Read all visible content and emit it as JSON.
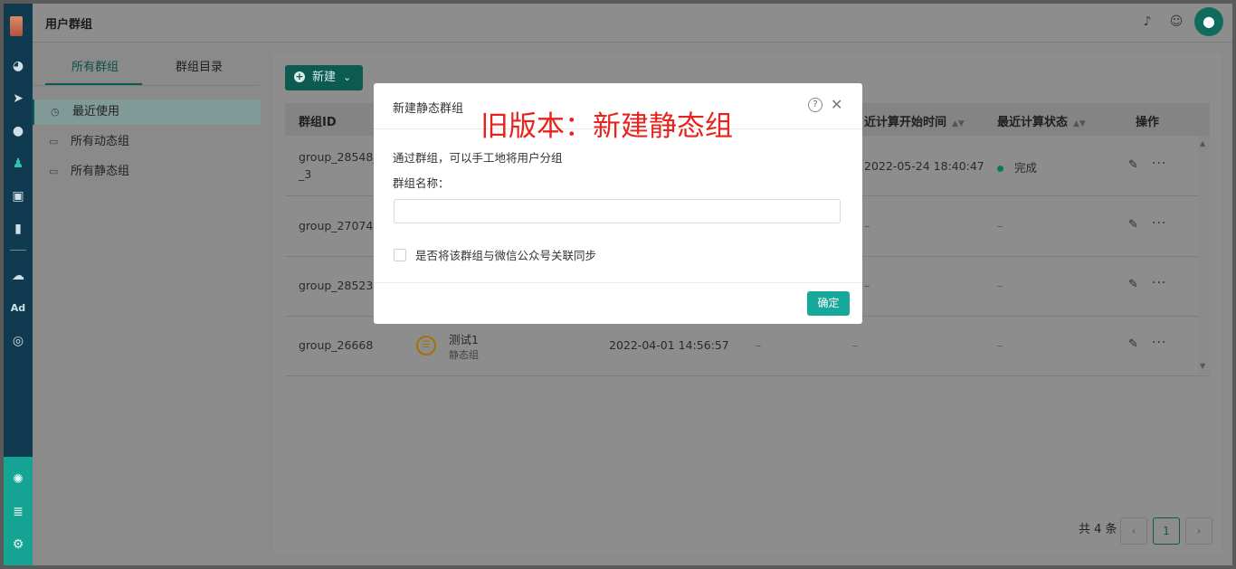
{
  "header": {
    "title": "用户群组"
  },
  "subsidebar": {
    "tabs": [
      {
        "label": "所有群组"
      },
      {
        "label": "群组目录"
      }
    ],
    "items": [
      {
        "label": "最近使用"
      },
      {
        "label": "所有动态组"
      },
      {
        "label": "所有静态组"
      }
    ]
  },
  "toolbar": {
    "new_label": "新建"
  },
  "table": {
    "columns": [
      "群组ID",
      "近计算开始时间",
      "最近计算状态",
      "操作"
    ],
    "rows": [
      {
        "id": "group_28548_c",
        "id2": "_3",
        "start": "2022-05-24 18:40:47",
        "status": "完成"
      },
      {
        "id": "group_27074",
        "start": "–",
        "status": "–"
      },
      {
        "id": "group_28523",
        "start": "–",
        "status": "–"
      },
      {
        "id": "group_26668",
        "name": "测试1",
        "type": "静态组",
        "created": "2022-04-01 14:56:57",
        "c4": "–",
        "start": "–",
        "status": "–"
      }
    ]
  },
  "pagination": {
    "total": "共 4 条",
    "current": "1"
  },
  "modal": {
    "title": "新建静态群组",
    "description": "通过群组，可以手工地将用户分组",
    "field_label": "群组名称：",
    "field_value": "",
    "checkbox_label": "是否将该群组与微信公众号关联同步",
    "ok_label": "确定",
    "annotation": "旧版本：新建静态组"
  },
  "colors": {
    "accent": "#16a89a",
    "rail": "#0f3a4f",
    "annotation": "#e8221c"
  }
}
